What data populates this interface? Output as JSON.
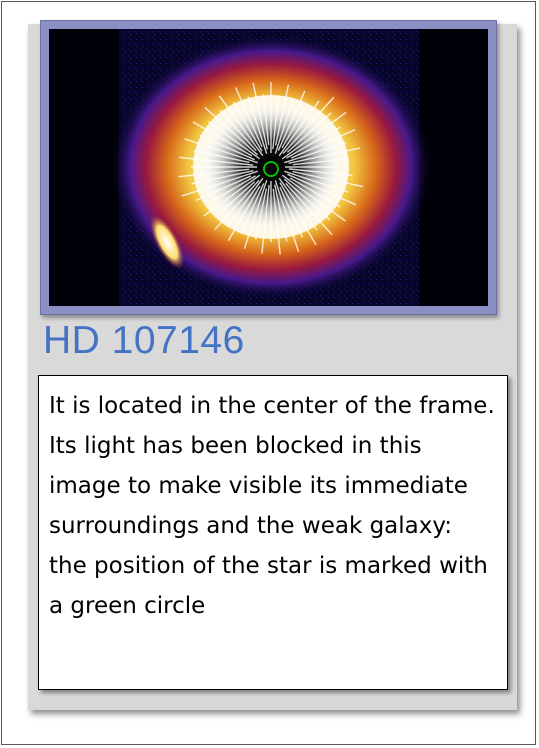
{
  "title": "HD 107146",
  "description": "It is located in the center of the frame. Its light has been blocked in this image to make visible its immediate surroundings and the weak galaxy: the position of the star is marked with a green circle",
  "image": {
    "subject": "debris-disk",
    "marker_color": "#00c000",
    "colors": {
      "background": "#000008",
      "disk_outer": "#3a1a8a",
      "disk_mid": "#e07020",
      "disk_inner": "#ffe060",
      "core": "#ffffff"
    }
  },
  "accent_color": "#4472c4"
}
